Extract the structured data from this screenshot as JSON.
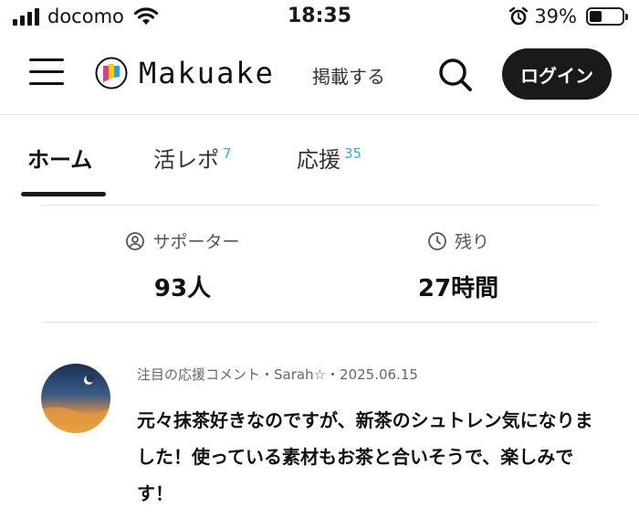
{
  "status_bar": {
    "carrier": "docomo",
    "time": "18:35",
    "battery_percent": "39%",
    "battery_level": 0.39
  },
  "header": {
    "logo_text": "Makuake",
    "post_link": "掲載する",
    "login_label": "ログイン"
  },
  "tabs": [
    {
      "label": "ホーム",
      "count": ""
    },
    {
      "label": "活レポ",
      "count": "7"
    },
    {
      "label": "応援",
      "count": "35"
    }
  ],
  "stats": {
    "supporters_label": "サポーター",
    "supporters_value": "93人",
    "remaining_label": "残り",
    "remaining_value": "27時間"
  },
  "comment": {
    "meta": "注目の応援コメント・Sarah☆・2025.06.15",
    "text": "元々抹茶好きなのですが、新茶のシュトレン気になりました！使っている素材もお茶と合いそうで、楽しみです！"
  },
  "colors": {
    "accent_blue": "#3fa8d6",
    "button_dark": "#1a1a1a",
    "logo_yellow": "#f5d200",
    "logo_pink": "#e8368f",
    "logo_blue": "#29a3dd"
  }
}
